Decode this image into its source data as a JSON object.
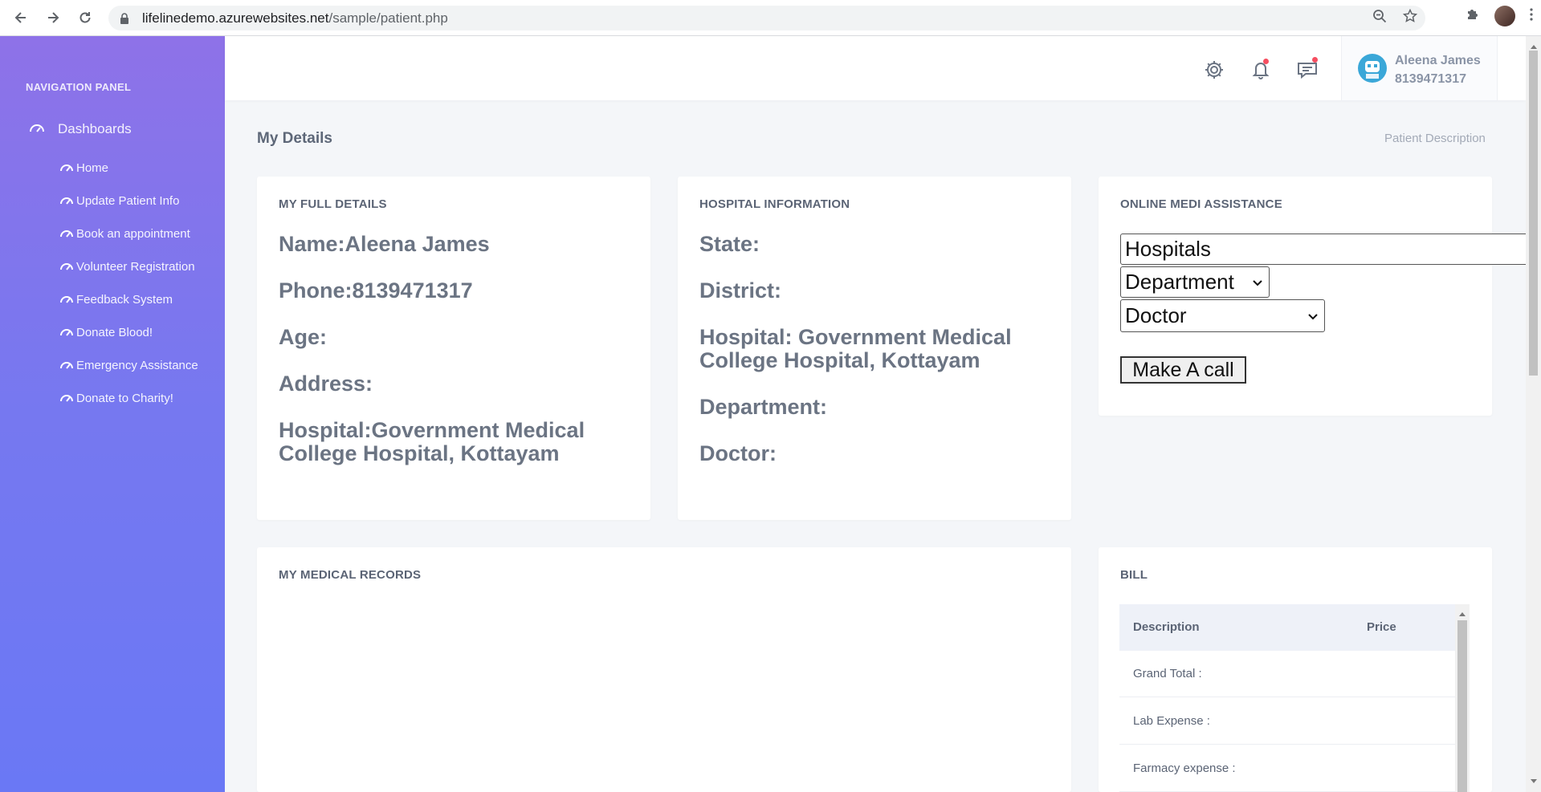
{
  "browser": {
    "url_host": "lifelinedemo.azurewebsites.net",
    "url_path": "/sample/patient.php"
  },
  "sidebar": {
    "panel_title": "NAVIGATION PANEL",
    "dashboards_label": "Dashboards",
    "items": [
      {
        "label": "Home"
      },
      {
        "label": "Update Patient Info"
      },
      {
        "label": "Book an appointment"
      },
      {
        "label": "Volunteer Registration"
      },
      {
        "label": "Feedback System"
      },
      {
        "label": "Donate Blood!"
      },
      {
        "label": "Emergency Assistance"
      },
      {
        "label": "Donate to Charity!"
      }
    ]
  },
  "topbar": {
    "user_name": "Aleena James",
    "user_phone": "8139471317"
  },
  "page": {
    "title": "My Details",
    "breadcrumb": "Patient Description"
  },
  "full_details": {
    "title": "MY FULL DETAILS",
    "name": "Name:Aleena James",
    "phone": "Phone:8139471317",
    "age": "Age:",
    "address": "Address:",
    "hospital_line1": "Hospital:Government Medical",
    "hospital_line2": "College Hospital, Kottayam"
  },
  "hospital_info": {
    "title": "HOSPITAL INFORMATION",
    "state": "State:",
    "district": "District:",
    "hospital_line1": "Hospital: Government Medical",
    "hospital_line2": "College Hospital, Kottayam",
    "department": "Department:",
    "doctor": "Doctor:"
  },
  "medi_assist": {
    "title": "ONLINE MEDI ASSISTANCE",
    "hospital_value": "Hospitals",
    "department_value": "Department",
    "doctor_value": "Doctor",
    "call_button": "Make A call"
  },
  "medical_records": {
    "title": "MY MEDICAL RECORDS"
  },
  "bill": {
    "title": "BILL",
    "col_description": "Description",
    "col_price": "Price",
    "rows": [
      {
        "description": "Grand Total :"
      },
      {
        "description": "Lab Expense :"
      },
      {
        "description": "Farmacy expense :"
      }
    ]
  },
  "colors": {
    "sidebar_top": "#8e72e8",
    "sidebar_bottom": "#6a78f5",
    "notification_dot": "#f64e60",
    "avatar": "#3aa7d8"
  }
}
